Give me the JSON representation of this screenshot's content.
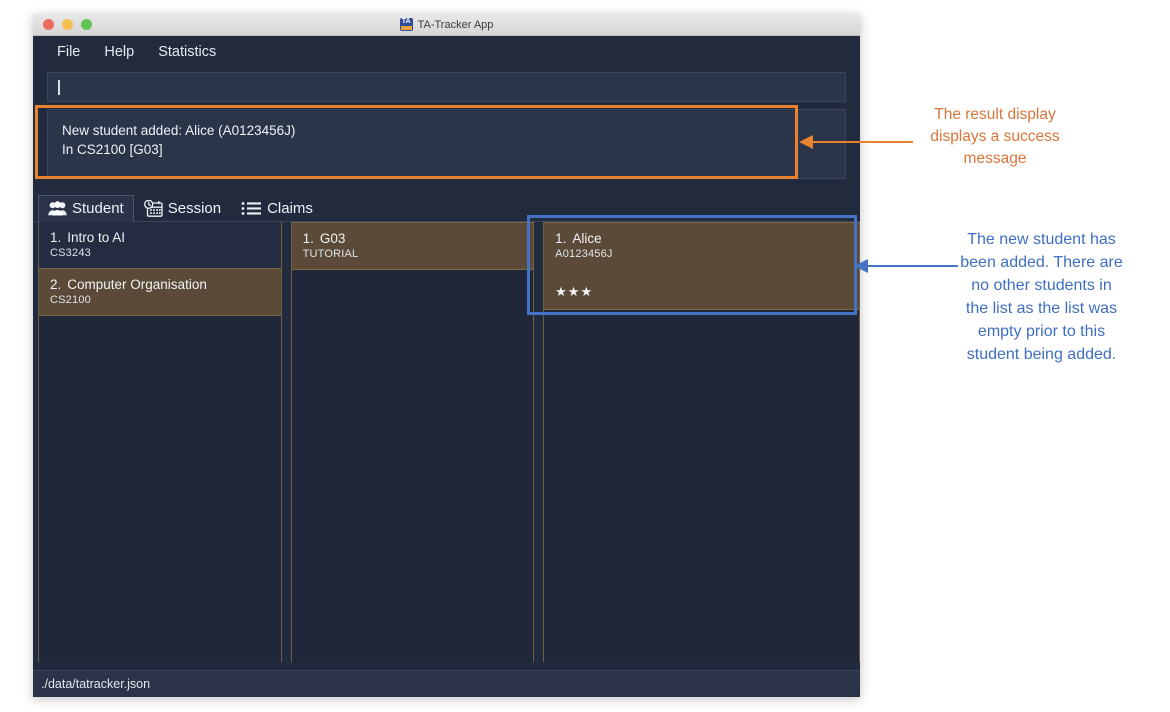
{
  "window": {
    "title": "TA-Tracker App",
    "app_icon": "ta-tracker-logo",
    "traffic_lights": [
      "close",
      "minimize",
      "zoom"
    ]
  },
  "menubar": {
    "items": [
      {
        "label": "File"
      },
      {
        "label": "Help"
      },
      {
        "label": "Statistics"
      }
    ]
  },
  "command_box": {
    "value": "",
    "placeholder": ""
  },
  "result_display": {
    "lines": [
      "New student added: Alice (A0123456J)",
      "In CS2100 [G03]"
    ]
  },
  "tabs": [
    {
      "label": "Student",
      "icon": "people-icon",
      "selected": true
    },
    {
      "label": "Session",
      "icon": "calendar-clock-icon",
      "selected": false
    },
    {
      "label": "Claims",
      "icon": "bulleted-list-icon",
      "selected": false
    }
  ],
  "modules_panel": {
    "items": [
      {
        "index": "1.",
        "name": "Intro to AI",
        "code": "CS3243",
        "selected": false
      },
      {
        "index": "2.",
        "name": "Computer Organisation",
        "code": "CS2100",
        "selected": true
      }
    ]
  },
  "sessions_panel": {
    "items": [
      {
        "index": "1.",
        "name": "G03",
        "type": "TUTORIAL",
        "selected": true
      }
    ]
  },
  "students_panel": {
    "items": [
      {
        "index": "1.",
        "name": "Alice",
        "id": "A0123456J",
        "rating": "★★★",
        "selected": true
      }
    ]
  },
  "statusbar": {
    "path": "./data/tatracker.json"
  },
  "annotations": {
    "result": {
      "text": "The result display displays a success message",
      "color": "#d9753a"
    },
    "student": {
      "text": "The new student has been added. There are no other students in the list as the list was empty prior to this student being added.",
      "color": "#3f6fc0"
    }
  }
}
